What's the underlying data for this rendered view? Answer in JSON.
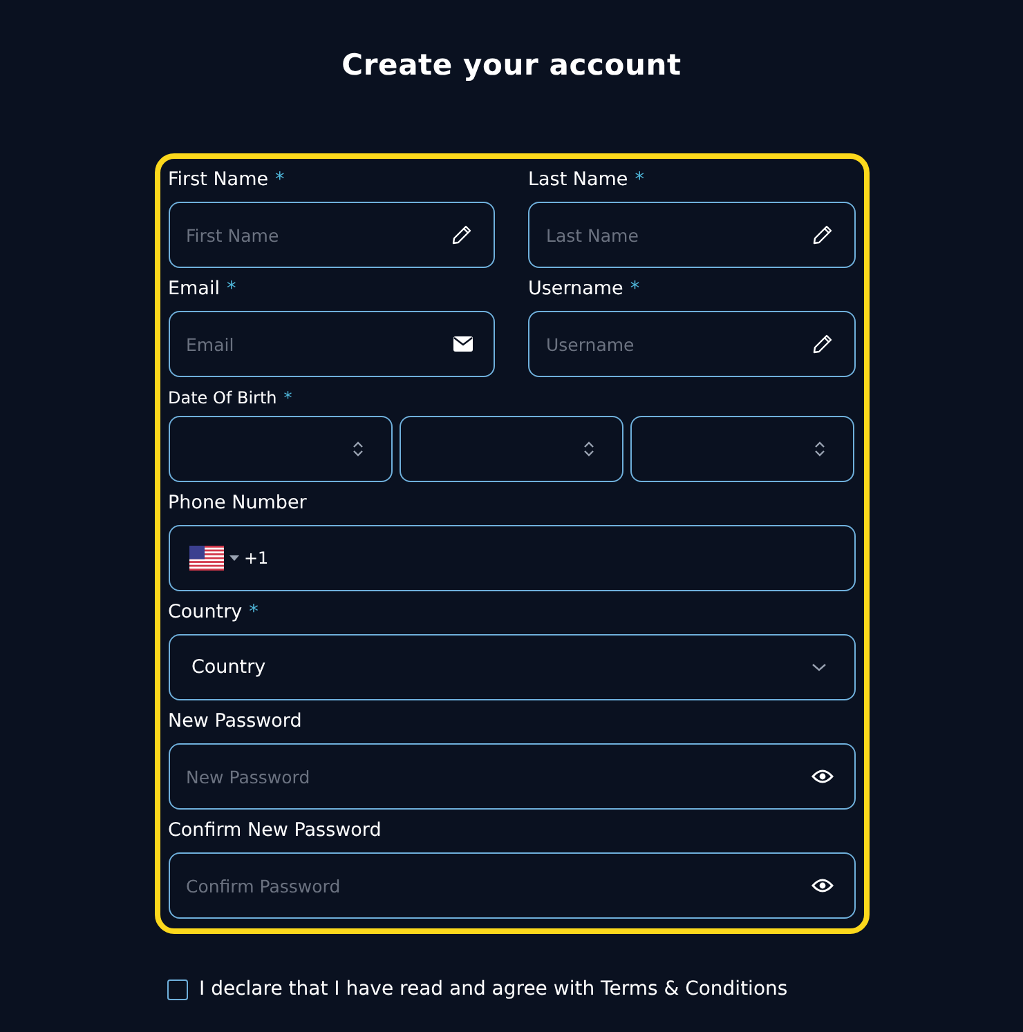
{
  "title": "Create your account",
  "form": {
    "fields": [
      {
        "kind": "text",
        "label": "First Name",
        "required_mark": "*",
        "placeholder": "First Name"
      },
      {
        "kind": "text",
        "label": "Last Name",
        "required_mark": "*",
        "placeholder": "Last Name"
      },
      {
        "kind": "email",
        "label": "Email",
        "required_mark": "*",
        "placeholder": "Email"
      },
      {
        "kind": "text",
        "label": "Username",
        "required_mark": "*",
        "placeholder": "Username"
      },
      {
        "kind": "date",
        "label": "Date Of Birth",
        "required_mark": "*"
      },
      {
        "kind": "phone",
        "label": "Phone Number",
        "dial_code": "+1"
      },
      {
        "kind": "select",
        "label": "Country",
        "required_mark": "*",
        "value": "Country"
      },
      {
        "kind": "password",
        "label": "New Password",
        "placeholder": "New Password"
      },
      {
        "kind": "password",
        "label": "Confirm New Password",
        "placeholder": "Confirm Password"
      }
    ]
  },
  "agreement": {
    "text": "I declare that I have read and agree with Terms & Conditions",
    "checked": false
  }
}
